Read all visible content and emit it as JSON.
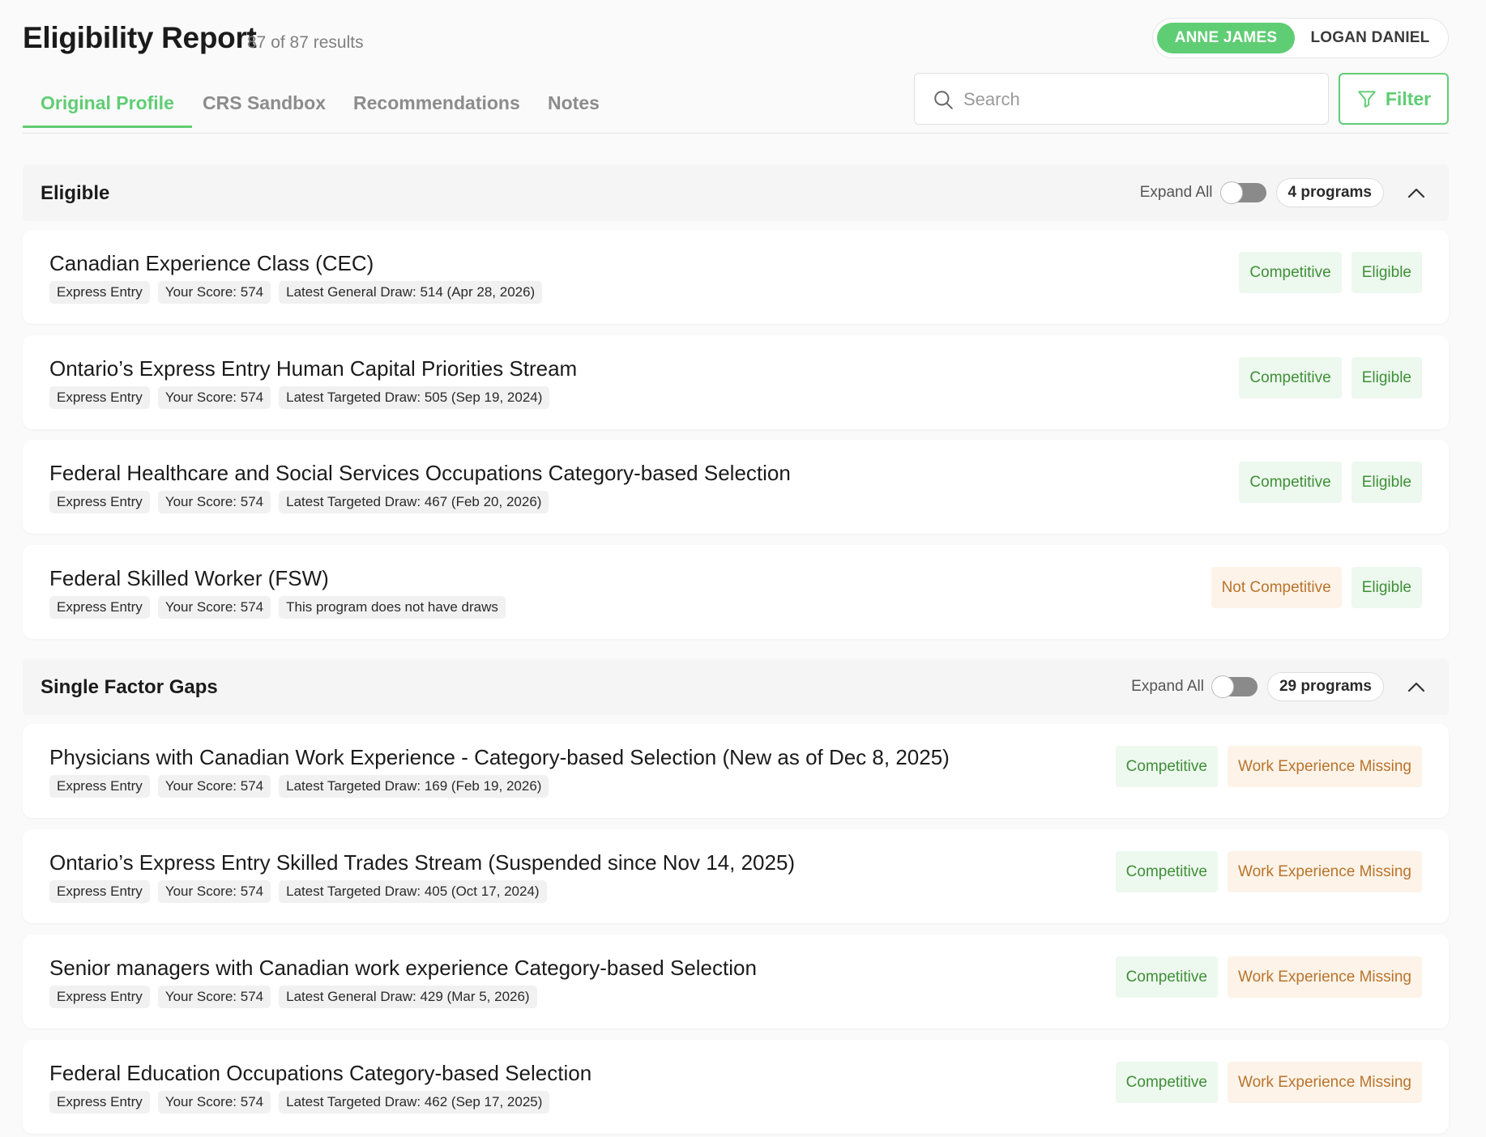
{
  "header": {
    "title": "Eligibility Report",
    "result_count": "87 of 87 results",
    "users": [
      "ANNE JAMES",
      "LOGAN DANIEL"
    ],
    "active_user": "ANNE JAMES"
  },
  "tabs": [
    "Original Profile",
    "CRS Sandbox",
    "Recommendations",
    "Notes"
  ],
  "active_tab": "Original Profile",
  "search": {
    "placeholder": "Search",
    "value": ""
  },
  "filter": {
    "label": "Filter"
  },
  "colors": {
    "accent": "#5fcd74",
    "green_badge_text": "#3f8f37",
    "orange_badge_text": "#b8742d"
  },
  "sections": [
    {
      "title": "Eligible",
      "expand_label": "Expand All",
      "expand_on": false,
      "count": "4 programs",
      "programs": [
        {
          "title": "Canadian Experience Class (CEC)",
          "chips": [
            "Express Entry",
            "Your Score: 574",
            "Latest General Draw: 514 (Apr 28, 2026)"
          ],
          "badges": [
            {
              "text": "Competitive",
              "tone": "green"
            },
            {
              "text": "Eligible",
              "tone": "green"
            }
          ]
        },
        {
          "title": "Ontario’s Express Entry Human Capital Priorities Stream",
          "chips": [
            "Express Entry",
            "Your Score: 574",
            "Latest Targeted Draw: 505 (Sep 19, 2024)"
          ],
          "badges": [
            {
              "text": "Competitive",
              "tone": "green"
            },
            {
              "text": "Eligible",
              "tone": "green"
            }
          ]
        },
        {
          "title": "Federal Healthcare and Social Services Occupations Category-based Selection",
          "chips": [
            "Express Entry",
            "Your Score: 574",
            "Latest Targeted Draw: 467 (Feb 20, 2026)"
          ],
          "badges": [
            {
              "text": "Competitive",
              "tone": "green"
            },
            {
              "text": "Eligible",
              "tone": "green"
            }
          ]
        },
        {
          "title": "Federal Skilled Worker (FSW)",
          "chips": [
            "Express Entry",
            "Your Score: 574",
            "This program does not have draws"
          ],
          "badges": [
            {
              "text": "Not Competitive",
              "tone": "orange"
            },
            {
              "text": "Eligible",
              "tone": "green"
            }
          ]
        }
      ]
    },
    {
      "title": "Single Factor Gaps",
      "expand_label": "Expand All",
      "expand_on": false,
      "count": "29 programs",
      "programs": [
        {
          "title": "Physicians with Canadian Work Experience - Category-based Selection (New as of Dec 8, 2025)",
          "chips": [
            "Express Entry",
            "Your Score: 574",
            "Latest Targeted Draw: 169 (Feb 19, 2026)"
          ],
          "badges": [
            {
              "text": "Competitive",
              "tone": "green"
            },
            {
              "text": "Work Experience Missing",
              "tone": "orange"
            }
          ]
        },
        {
          "title": "Ontario’s Express Entry Skilled Trades Stream (Suspended since Nov 14, 2025)",
          "chips": [
            "Express Entry",
            "Your Score: 574",
            "Latest Targeted Draw: 405 (Oct 17, 2024)"
          ],
          "badges": [
            {
              "text": "Competitive",
              "tone": "green"
            },
            {
              "text": "Work Experience Missing",
              "tone": "orange"
            }
          ]
        },
        {
          "title": "Senior managers with Canadian work experience Category-based Selection",
          "chips": [
            "Express Entry",
            "Your Score: 574",
            "Latest General Draw: 429 (Mar 5, 2026)"
          ],
          "badges": [
            {
              "text": "Competitive",
              "tone": "green"
            },
            {
              "text": "Work Experience Missing",
              "tone": "orange"
            }
          ]
        },
        {
          "title": "Federal Education Occupations Category-based Selection",
          "chips": [
            "Express Entry",
            "Your Score: 574",
            "Latest Targeted Draw: 462 (Sep 17, 2025)"
          ],
          "badges": [
            {
              "text": "Competitive",
              "tone": "green"
            },
            {
              "text": "Work Experience Missing",
              "tone": "orange"
            }
          ]
        }
      ]
    }
  ]
}
